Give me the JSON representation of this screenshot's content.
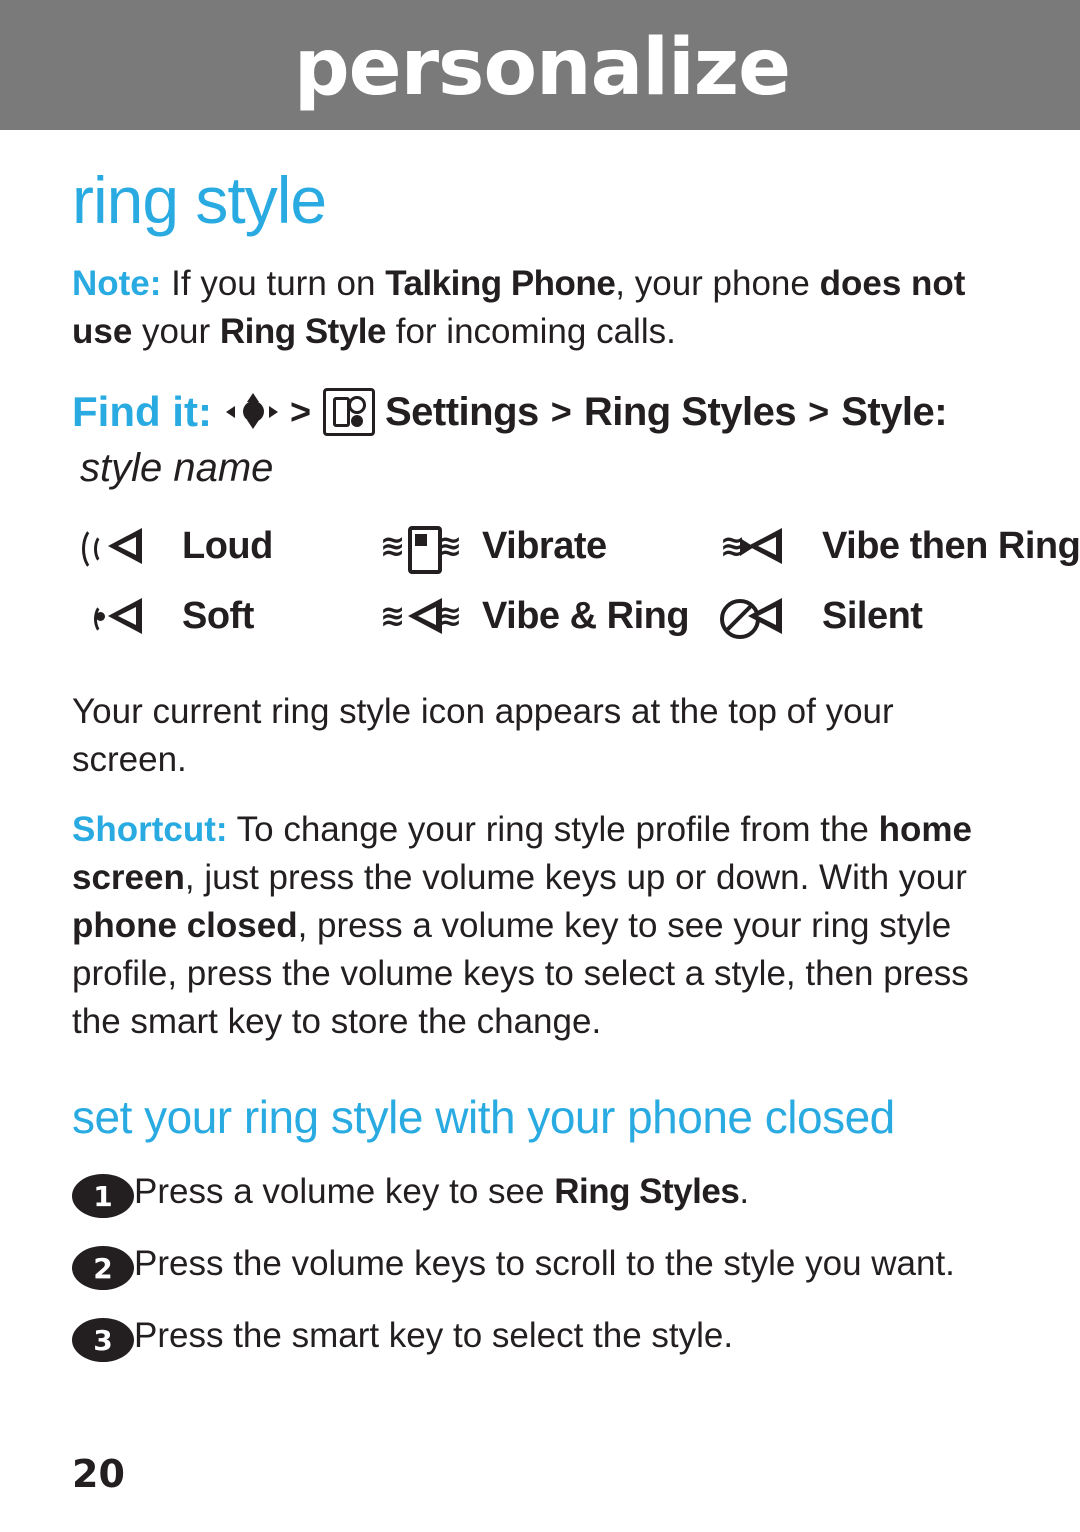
{
  "header": {
    "title": "personalize"
  },
  "section": {
    "title": "ring style"
  },
  "note": {
    "label": "Note:",
    "part1": " If you turn on ",
    "emphasis1": "Talking Phone",
    "part2": ", your phone ",
    "emphasis2": "does not use",
    "part3": " your ",
    "emphasis3": "Ring Style",
    "part4": " for incoming calls."
  },
  "find_it": {
    "label": "Find it:",
    "sep1": ">",
    "sep2": ">",
    "sep3": ">",
    "settings": "Settings",
    "ring_styles": "Ring Styles",
    "style": "Style:",
    "style_name": "style name",
    "nav_icon": "nav-key-icon",
    "settings_icon": "settings-wrench-icon"
  },
  "ring_styles": [
    {
      "label": "Loud",
      "icon": "speaker-loud-icon"
    },
    {
      "label": "Vibrate",
      "icon": "phone-vibrate-icon"
    },
    {
      "label": "Vibe then Ring",
      "icon": "vibrate-then-ring-icon"
    },
    {
      "label": "Soft",
      "icon": "speaker-soft-icon"
    },
    {
      "label": "Vibe & Ring",
      "icon": "vibrate-and-ring-icon"
    },
    {
      "label": "Silent",
      "icon": "speaker-silent-icon"
    }
  ],
  "current_icon_note": "Your current ring style icon appears at the top of your screen.",
  "shortcut": {
    "label": "Shortcut:",
    "part1": " To change your ring style profile from the ",
    "emphasis1": "home screen",
    "part2": ", just press the volume keys up or down. With your ",
    "emphasis2": "phone closed",
    "part3": ", press a volume key to see your ring style profile, press the volume keys to select a style, then press the smart key to store the change."
  },
  "subsection": {
    "title": "set your ring style with your phone closed"
  },
  "steps": [
    {
      "num": "1",
      "text_before": "Press a volume key to see ",
      "emphasis": "Ring Styles",
      "text_after": "."
    },
    {
      "num": "2",
      "text_before": "Press the volume keys to scroll to the style you want.",
      "emphasis": "",
      "text_after": ""
    },
    {
      "num": "3",
      "text_before": "Press the smart key to select the style.",
      "emphasis": "",
      "text_after": ""
    }
  ],
  "page_number": "20",
  "colors": {
    "accent": "#29abe2",
    "header_band": "#7a7a7a",
    "text": "#231f20"
  }
}
